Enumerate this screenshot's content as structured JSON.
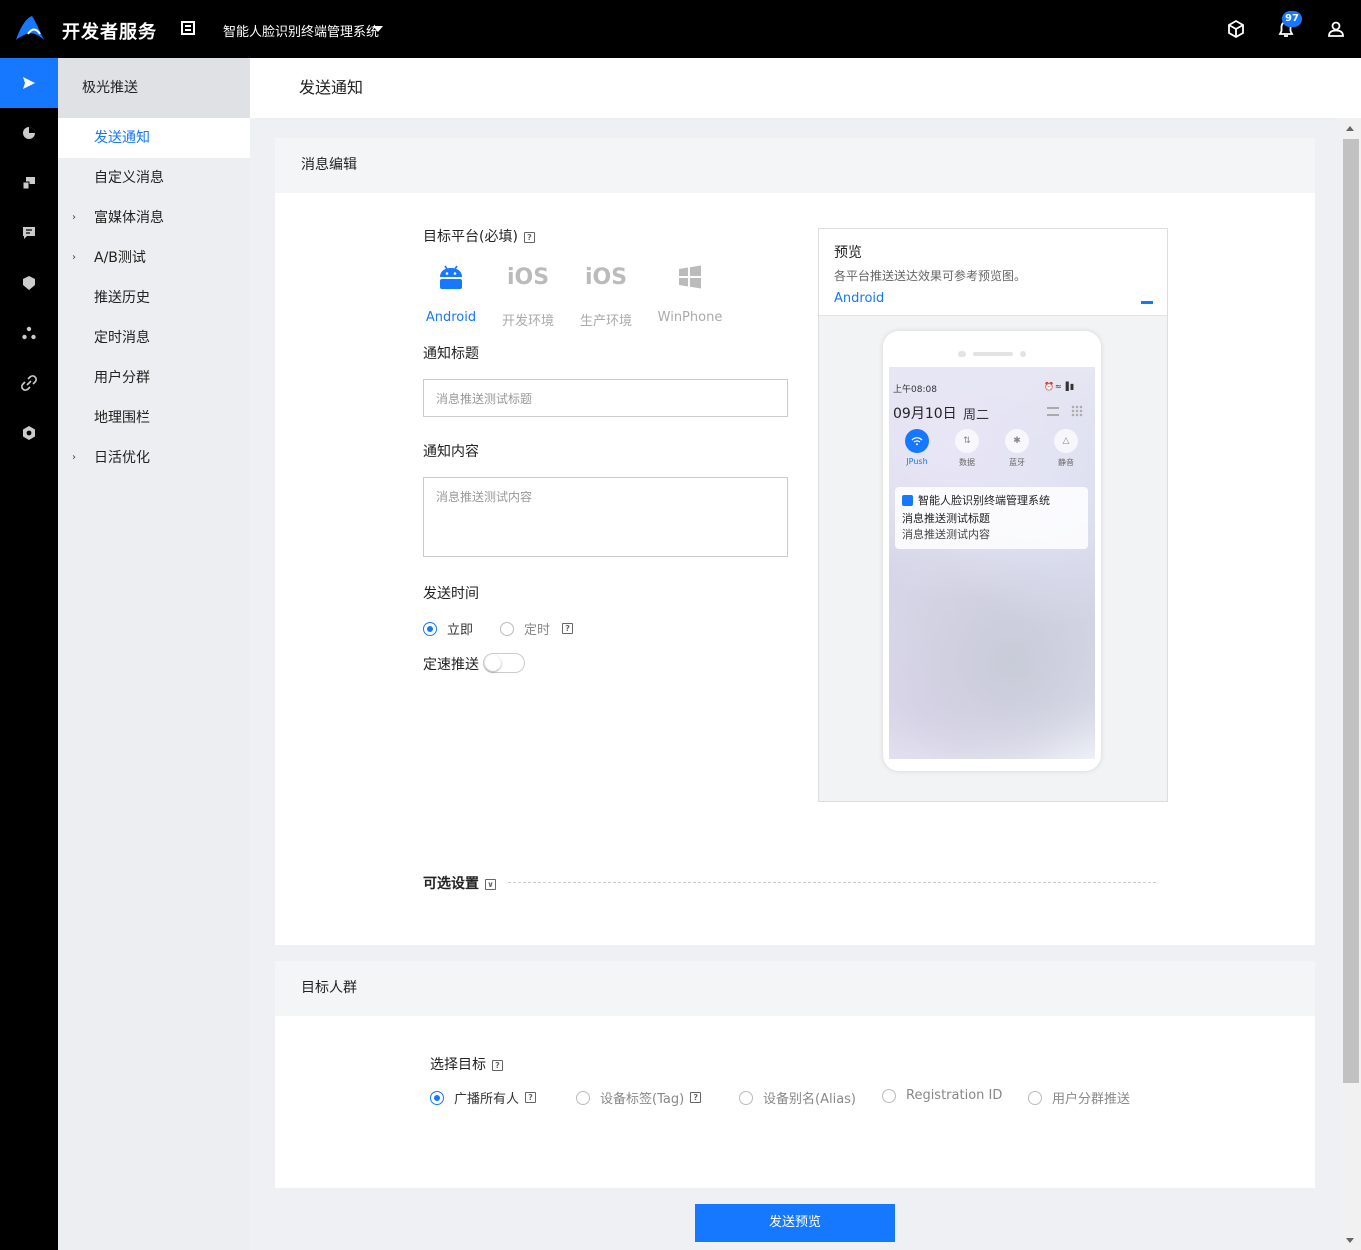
{
  "topbar": {
    "brand": "开发者服务",
    "app_name": "智能人脸识别终端管理系统",
    "notification_count": "97",
    "icons": [
      "logo-icon",
      "app-icon",
      "cube-icon",
      "bell-icon",
      "user-icon"
    ]
  },
  "rail": {
    "icons": [
      "push-icon",
      "pie-chart-icon",
      "devices-icon",
      "chat-icon",
      "shield-icon",
      "cluster-icon",
      "link-icon",
      "settings-icon"
    ],
    "active_index": 0
  },
  "subnav": {
    "title": "极光推送",
    "items": [
      {
        "label": "发送通知",
        "active": true,
        "expandable": false
      },
      {
        "label": "自定义消息",
        "active": false,
        "expandable": false
      },
      {
        "label": "富媒体消息",
        "active": false,
        "expandable": true
      },
      {
        "label": "A/B测试",
        "active": false,
        "expandable": true
      },
      {
        "label": "推送历史",
        "active": false,
        "expandable": false
      },
      {
        "label": "定时消息",
        "active": false,
        "expandable": false
      },
      {
        "label": "用户分群",
        "active": false,
        "expandable": false
      },
      {
        "label": "地理围栏",
        "active": false,
        "expandable": false
      },
      {
        "label": "日活优化",
        "active": false,
        "expandable": true
      }
    ]
  },
  "page": {
    "title": "发送通知"
  },
  "message_card": {
    "title": "消息编辑",
    "platform_label": "目标平台(必填)",
    "platforms": [
      {
        "label": "Android",
        "selected": true,
        "icon": "android-icon"
      },
      {
        "label": "开发环境",
        "selected": false,
        "icon": "ios-icon",
        "glyph": "iOS"
      },
      {
        "label": "生产环境",
        "selected": false,
        "icon": "ios-icon",
        "glyph": "iOS"
      },
      {
        "label": "WinPhone",
        "selected": false,
        "icon": "windows-icon"
      }
    ],
    "title_label": "通知标题",
    "title_placeholder": "消息推送测试标题",
    "content_label": "通知内容",
    "content_placeholder": "消息推送测试内容",
    "send_time_label": "发送时间",
    "send_time_options": [
      {
        "label": "立即",
        "selected": true
      },
      {
        "label": "定时",
        "selected": false
      }
    ],
    "rate_limit_label": "定速推送",
    "rate_limit_on": false,
    "optional_label": "可选设置"
  },
  "preview": {
    "title": "预览",
    "description": "各平台推送送达效果可参考预览图。",
    "platform": "Android",
    "phone": {
      "time": "上午08:08",
      "date": "09月10日",
      "weekday": "周二",
      "quick_settings": [
        {
          "label": "JPush",
          "on": true,
          "icon": "wifi-icon"
        },
        {
          "label": "数据",
          "on": false,
          "icon": "data-icon"
        },
        {
          "label": "蓝牙",
          "on": false,
          "icon": "bluetooth-icon"
        },
        {
          "label": "静音",
          "on": false,
          "icon": "mute-icon"
        }
      ],
      "notification": {
        "app_name": "智能人脸识别终端管理系统",
        "title": "消息推送测试标题",
        "content": "消息推送测试内容"
      }
    }
  },
  "target_card": {
    "title": "目标人群",
    "select_label": "选择目标",
    "options": [
      {
        "label": "广播所有人",
        "selected": true,
        "help": true
      },
      {
        "label": "设备标签(Tag)",
        "selected": false,
        "help": true
      },
      {
        "label": "设备别名(Alias)",
        "selected": false,
        "help": false
      },
      {
        "label": "Registration ID",
        "selected": false,
        "help": false
      },
      {
        "label": "用户分群推送",
        "selected": false,
        "help": false
      }
    ]
  },
  "actions": {
    "send_preview": "发送预览"
  },
  "colors": {
    "accent": "#1677ff",
    "topbar": "#000000",
    "sidebar": "#eceef1"
  }
}
